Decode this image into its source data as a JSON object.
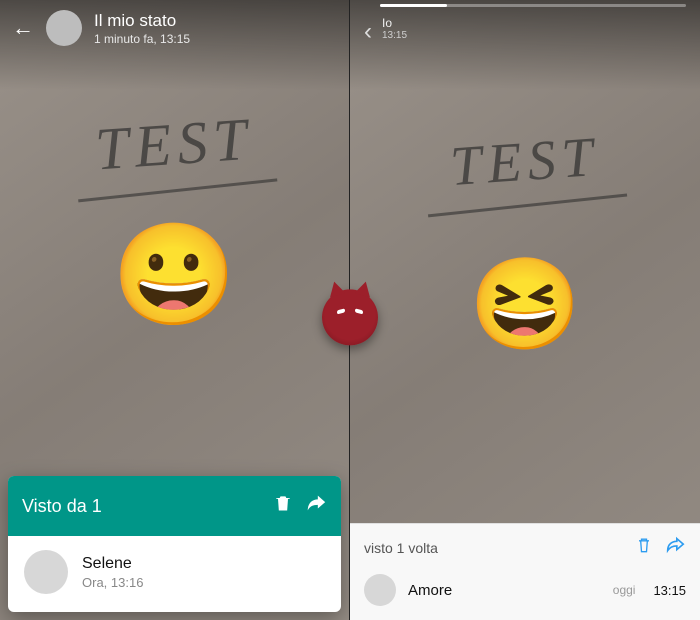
{
  "left": {
    "header": {
      "title": "Il mio stato",
      "subtitle": "1 minuto fa, 13:15"
    },
    "content": {
      "text": "TEST",
      "emoji": "😀"
    },
    "sheet": {
      "header_label": "Visto da 1",
      "viewer": {
        "name": "Selene",
        "time": "Ora, 13:16"
      }
    }
  },
  "right": {
    "header": {
      "who": "Io",
      "time": "13:15"
    },
    "content": {
      "text": "TEST",
      "emoji": "😆"
    },
    "bar": {
      "label": "visto 1 volta",
      "viewer": {
        "name": "Amore",
        "day": "oggi",
        "time": "13:15"
      }
    }
  }
}
